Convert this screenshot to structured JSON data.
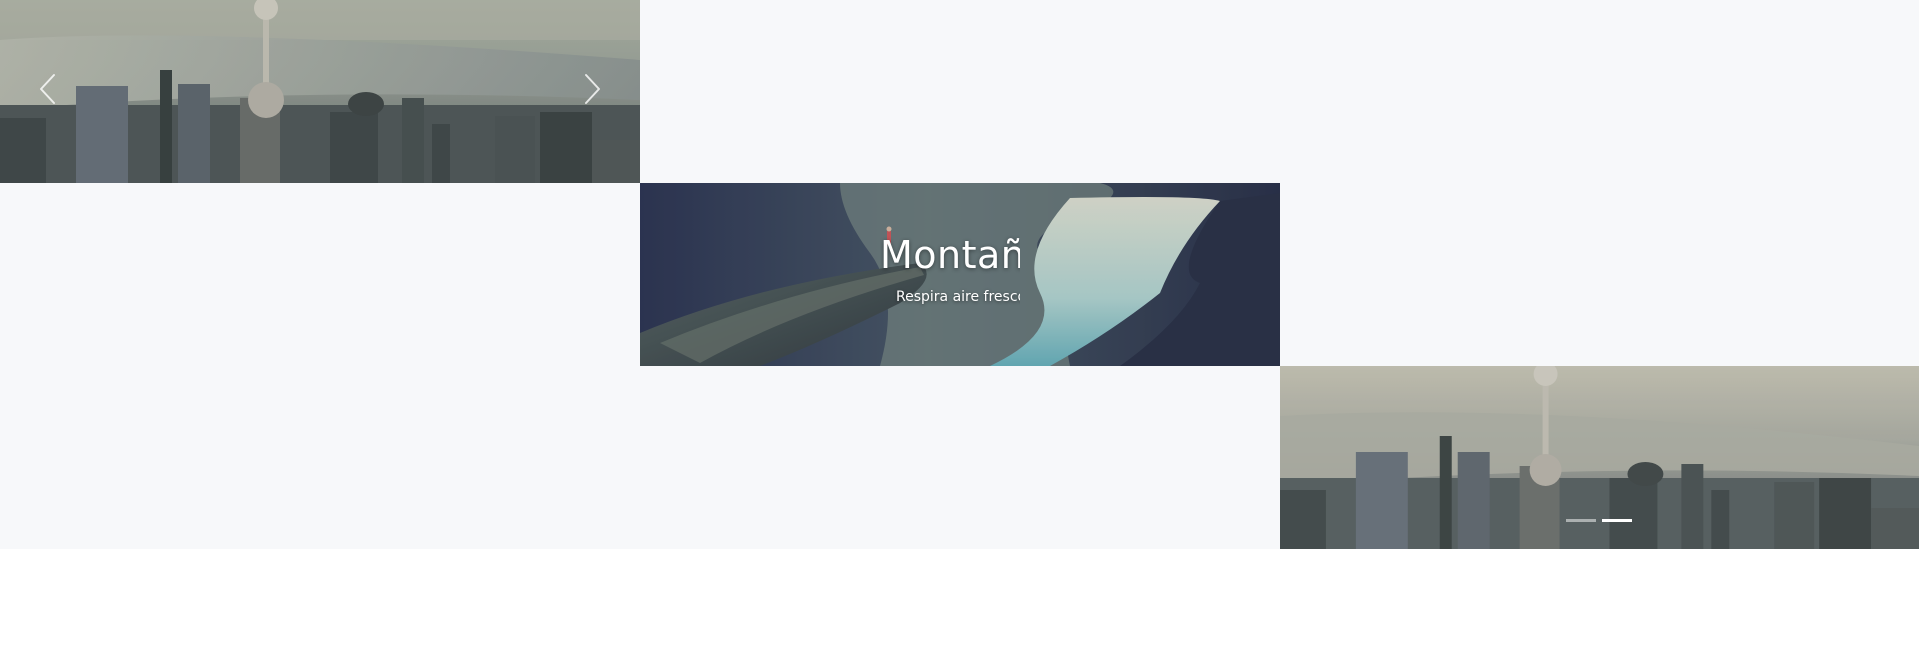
{
  "carousel": {
    "slides": [
      {
        "image": "shanghai-skyline-aerial",
        "title": "",
        "subtitle": ""
      },
      {
        "image": "mountain-fjord-cliff",
        "title": "Montañ",
        "subtitle": "Respira aire fresco"
      },
      {
        "image": "shanghai-skyline-aerial",
        "title": "",
        "subtitle": ""
      }
    ],
    "controls": {
      "prev_icon": "chevron-left-icon",
      "next_icon": "chevron-right-icon"
    },
    "indicators": [
      {
        "active": false
      },
      {
        "active": true
      }
    ]
  },
  "colors": {
    "stage_background": "#f7f8fa",
    "caption_text": "#ffffff",
    "indicator_active": "#ffffff"
  }
}
